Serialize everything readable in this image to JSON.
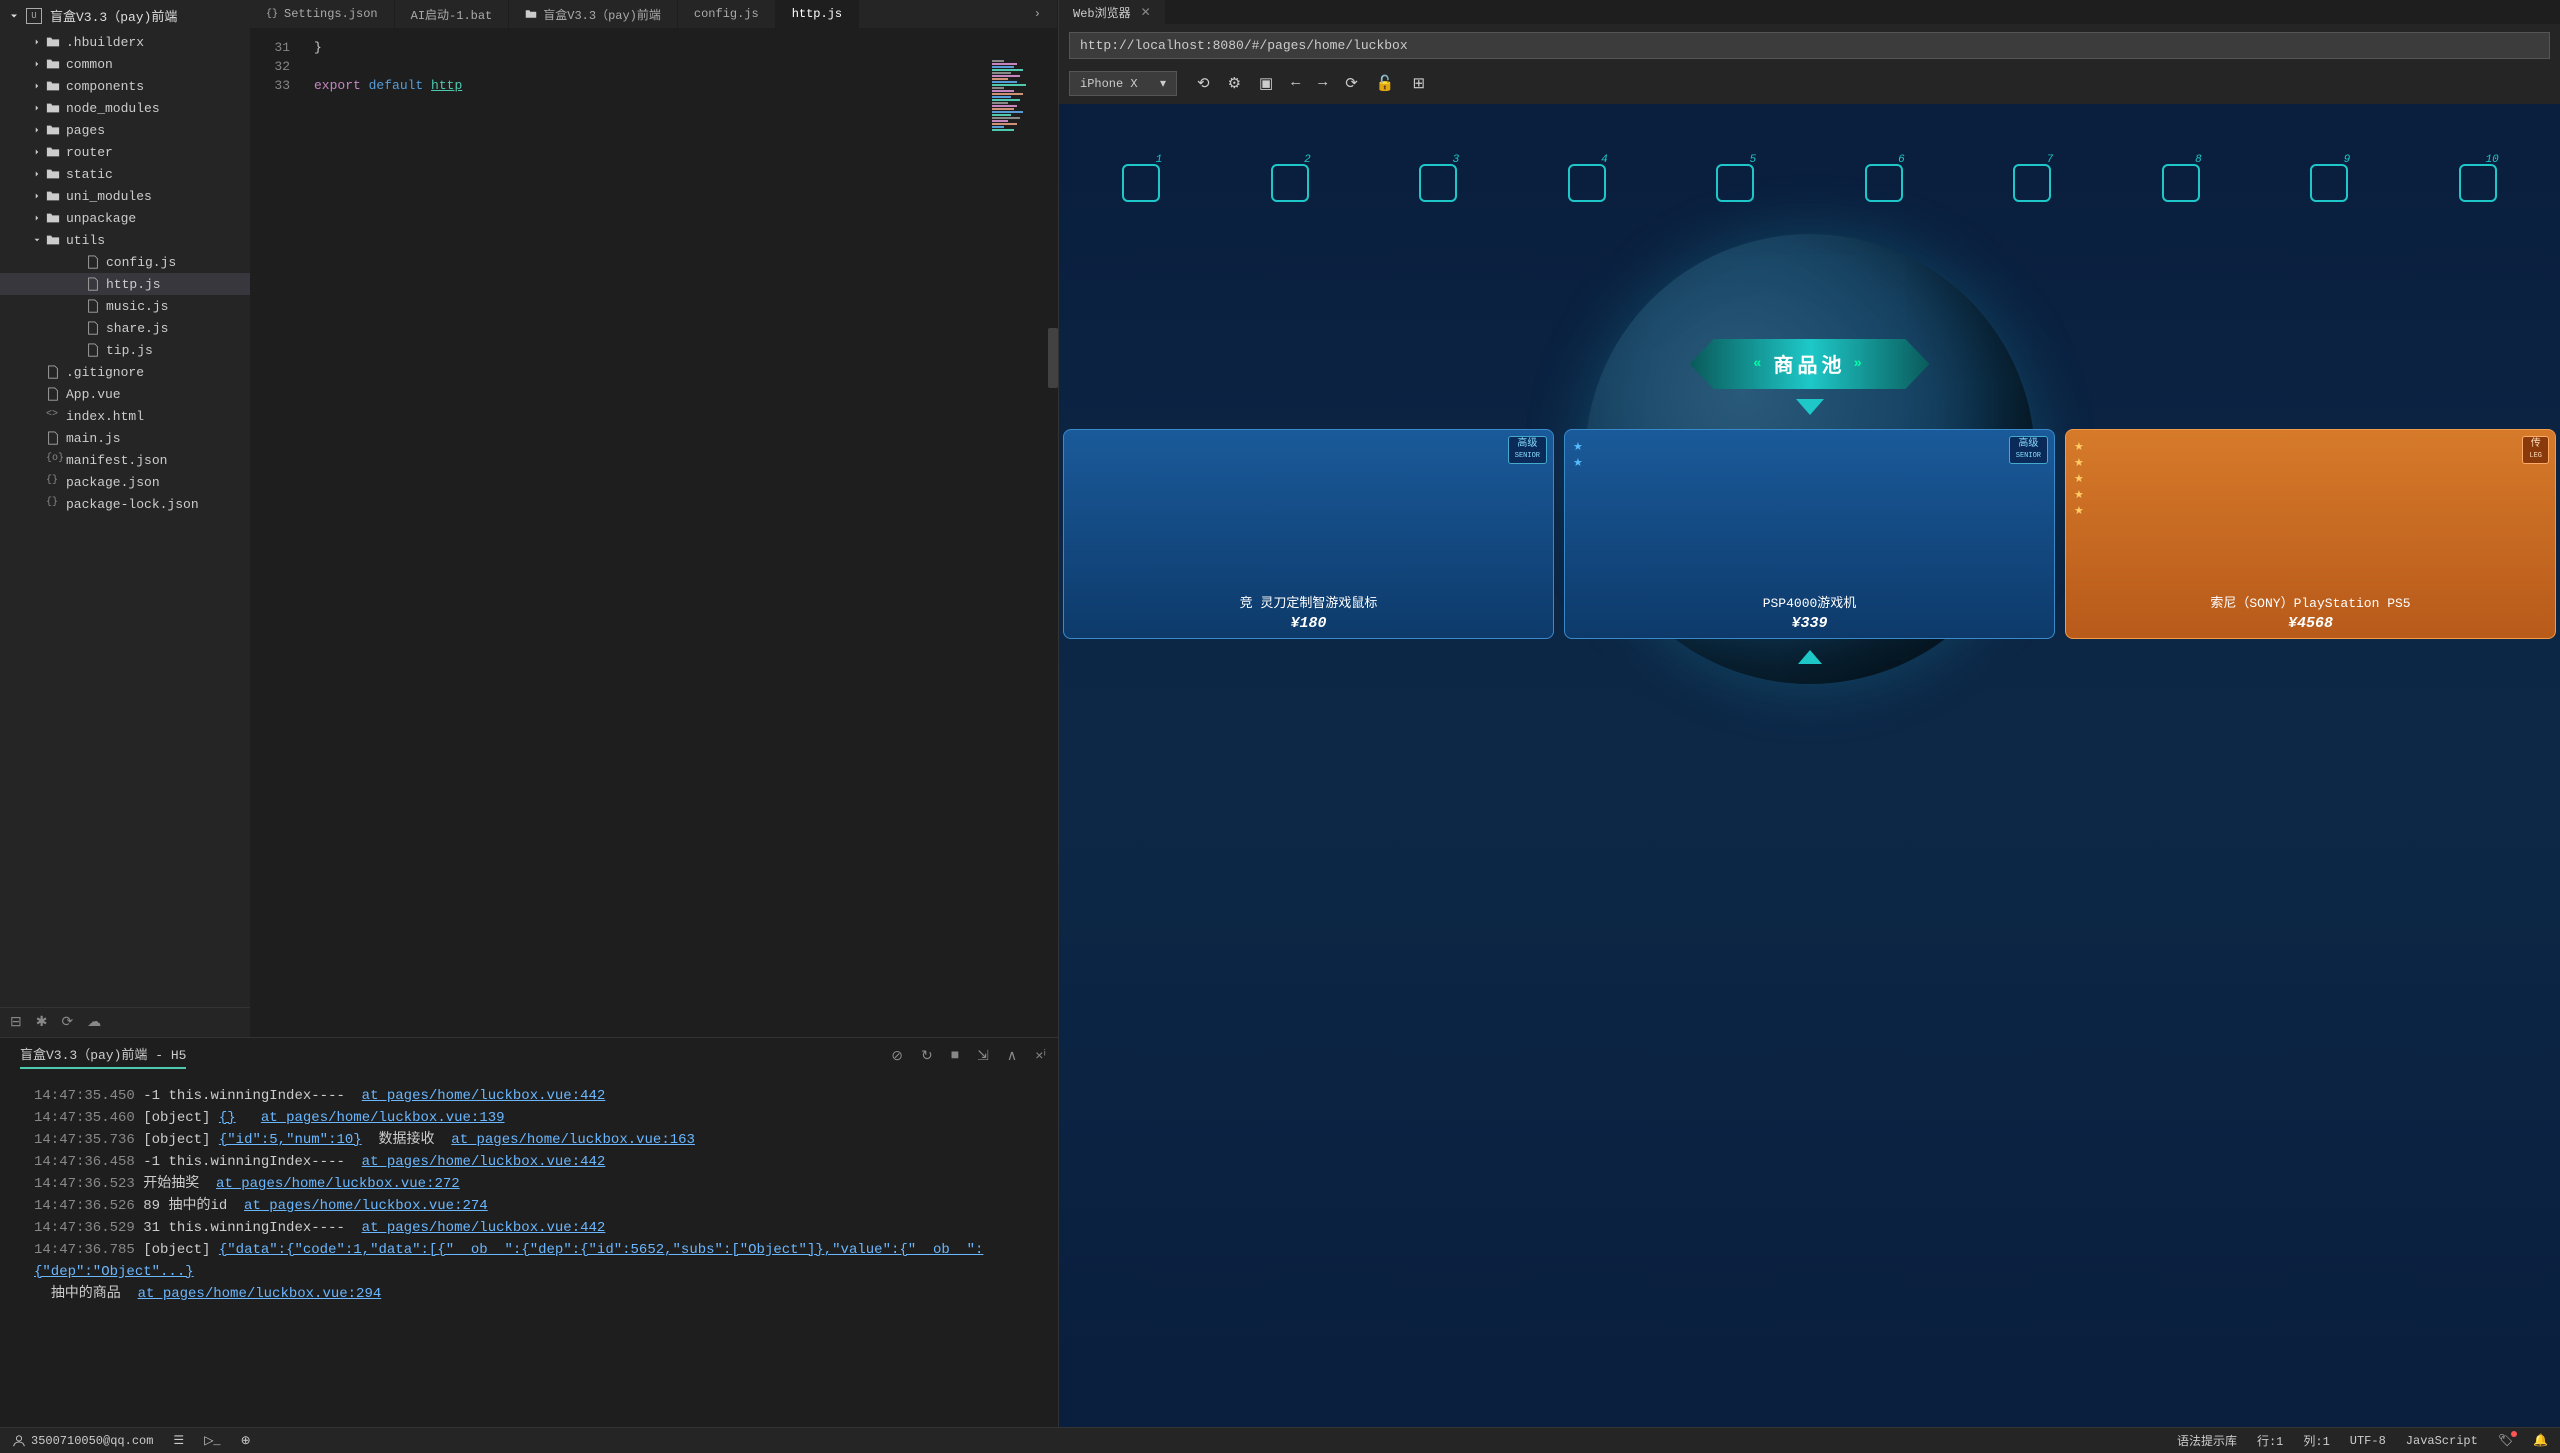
{
  "project": {
    "name": "盲盒V3.3（pay)前端"
  },
  "fileTree": [
    {
      "label": ".hbuilderx",
      "type": "folder",
      "depth": 1
    },
    {
      "label": "common",
      "type": "folder",
      "depth": 1
    },
    {
      "label": "components",
      "type": "folder",
      "depth": 1
    },
    {
      "label": "node_modules",
      "type": "folder",
      "depth": 1
    },
    {
      "label": "pages",
      "type": "folder",
      "depth": 1
    },
    {
      "label": "router",
      "type": "folder",
      "depth": 1
    },
    {
      "label": "static",
      "type": "folder",
      "depth": 1
    },
    {
      "label": "uni_modules",
      "type": "folder",
      "depth": 1
    },
    {
      "label": "unpackage",
      "type": "folder",
      "depth": 1
    },
    {
      "label": "utils",
      "type": "folder",
      "depth": 1,
      "expanded": true
    },
    {
      "label": "config.js",
      "type": "file",
      "depth": 2
    },
    {
      "label": "http.js",
      "type": "file",
      "depth": 2,
      "selected": true
    },
    {
      "label": "music.js",
      "type": "file",
      "depth": 2
    },
    {
      "label": "share.js",
      "type": "file",
      "depth": 2
    },
    {
      "label": "tip.js",
      "type": "file",
      "depth": 2
    },
    {
      "label": ".gitignore",
      "type": "file",
      "depth": 1
    },
    {
      "label": "App.vue",
      "type": "file",
      "depth": 1
    },
    {
      "label": "index.html",
      "type": "file",
      "depth": 1,
      "icon": "html"
    },
    {
      "label": "main.js",
      "type": "file",
      "depth": 1
    },
    {
      "label": "manifest.json",
      "type": "file",
      "depth": 1,
      "icon": "manifest"
    },
    {
      "label": "package.json",
      "type": "file",
      "depth": 1,
      "icon": "json"
    },
    {
      "label": "package-lock.json",
      "type": "file",
      "depth": 1,
      "icon": "json"
    }
  ],
  "tabs": [
    {
      "label": "Settings.json",
      "icon": "json"
    },
    {
      "label": "AI启动-1.bat"
    },
    {
      "label": "盲盒V3.3（pay)前端",
      "icon": "folder"
    },
    {
      "label": "config.js"
    },
    {
      "label": "http.js",
      "active": true
    }
  ],
  "editor": {
    "lines": [
      {
        "num": 31,
        "tokens": [
          {
            "t": "}",
            "c": ""
          }
        ]
      },
      {
        "num": 32,
        "tokens": []
      },
      {
        "num": 33,
        "tokens": [
          {
            "t": "export",
            "c": "kw-export"
          },
          {
            "t": " "
          },
          {
            "t": "default",
            "c": "kw-default"
          },
          {
            "t": " "
          },
          {
            "t": "http",
            "c": "kw-link"
          }
        ]
      }
    ]
  },
  "console": {
    "title": "盲盒V3.3（pay)前端 - H5",
    "lines": [
      {
        "ts": "14:47:35.450",
        "msg": "-1 this.winningIndex----  ",
        "link": "at pages/home/luckbox.vue:442"
      },
      {
        "ts": "14:47:35.460",
        "msg": "[object] ",
        "json": "{}",
        "post": "   ",
        "link": "at pages/home/luckbox.vue:139"
      },
      {
        "ts": "14:47:35.736",
        "msg": "[object] ",
        "json": "{\"id\":5,\"num\":10}",
        "post": "  数据接收  ",
        "link": "at pages/home/luckbox.vue:163"
      },
      {
        "ts": "14:47:36.458",
        "msg": "-1 this.winningIndex----  ",
        "link": "at pages/home/luckbox.vue:442"
      },
      {
        "ts": "14:47:36.523",
        "msg": "开始抽奖  ",
        "link": "at pages/home/luckbox.vue:272"
      },
      {
        "ts": "14:47:36.526",
        "msg": "89 抽中的id  ",
        "link": "at pages/home/luckbox.vue:274"
      },
      {
        "ts": "14:47:36.529",
        "msg": "31 this.winningIndex----  ",
        "link": "at pages/home/luckbox.vue:442"
      },
      {
        "ts": "14:47:36.785",
        "msg": "[object] ",
        "json": "{\"data\":{\"code\":1,\"data\":[{\"__ob__\":{\"dep\":{\"id\":5652,\"subs\":[\"Object\"]},\"value\":{\"__ob__\":{\"dep\":\"Object\"...}"
      },
      {
        "indent": "  ",
        "msg": "抽中的商品  ",
        "link": "at pages/home/luckbox.vue:294"
      }
    ]
  },
  "browser": {
    "tabTitle": "Web浏览器",
    "url": "http://localhost:8080/#/pages/home/luckbox",
    "device": "iPhone X"
  },
  "preview": {
    "bannerText": "商品池",
    "numbers": [
      "1",
      "2",
      "3",
      "4",
      "5",
      "6",
      "7",
      "8",
      "9",
      "10"
    ],
    "products": [
      {
        "name": "竞 灵刀定制智游戏鼠标",
        "price": "¥180",
        "badge": "高级",
        "badgeSub": "SENIOR",
        "type": "blue",
        "stars": 0
      },
      {
        "name": "PSP4000游戏机",
        "price": "¥339",
        "badge": "高级",
        "badgeSub": "SENIOR",
        "type": "blue",
        "stars": 2
      },
      {
        "name": "索尼（SONY）PlayStation PS5",
        "price": "¥4568",
        "badge": "传",
        "badgeSub": "LEG",
        "type": "orange",
        "stars": 5
      }
    ]
  },
  "statusBar": {
    "user": "3500710050@qq.com",
    "syntax": "语法提示库",
    "line": "行:1",
    "col": "列:1",
    "encoding": "UTF-8",
    "lang": "JavaScript"
  }
}
